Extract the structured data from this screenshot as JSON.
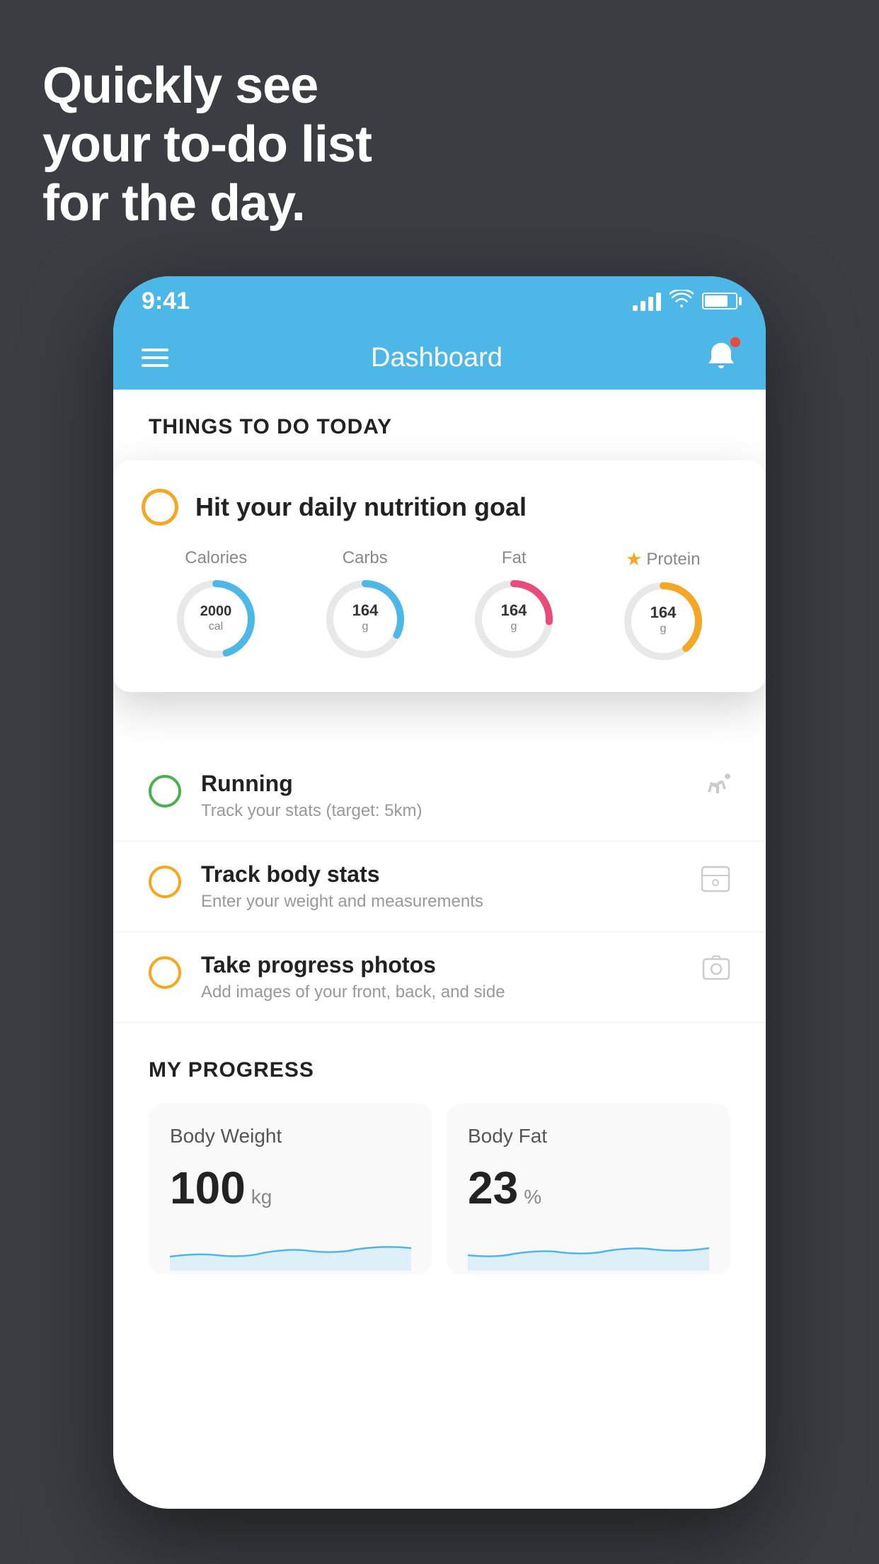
{
  "hero": {
    "line1": "Quickly see",
    "line2": "your to-do list",
    "line3": "for the day."
  },
  "status_bar": {
    "time": "9:41"
  },
  "nav": {
    "title": "Dashboard"
  },
  "things_today": {
    "header": "THINGS TO DO TODAY"
  },
  "floating_card": {
    "title": "Hit your daily nutrition goal",
    "nutrition": [
      {
        "label": "Calories",
        "value": "2000",
        "unit": "cal",
        "color": "#4db8e8",
        "star": false
      },
      {
        "label": "Carbs",
        "value": "164",
        "unit": "g",
        "color": "#4db8e8",
        "star": false
      },
      {
        "label": "Fat",
        "value": "164",
        "unit": "g",
        "color": "#e74c7c",
        "star": false
      },
      {
        "label": "Protein",
        "value": "164",
        "unit": "g",
        "color": "#f5a623",
        "star": true
      }
    ]
  },
  "todo_items": [
    {
      "title": "Running",
      "subtitle": "Track your stats (target: 5km)",
      "circle": "green",
      "icon": "👟"
    },
    {
      "title": "Track body stats",
      "subtitle": "Enter your weight and measurements",
      "circle": "yellow",
      "icon": "⚖️"
    },
    {
      "title": "Take progress photos",
      "subtitle": "Add images of your front, back, and side",
      "circle": "yellow",
      "icon": "🖼️"
    }
  ],
  "progress": {
    "header": "MY PROGRESS",
    "cards": [
      {
        "title": "Body Weight",
        "value": "100",
        "unit": "kg"
      },
      {
        "title": "Body Fat",
        "value": "23",
        "unit": "%"
      }
    ]
  }
}
